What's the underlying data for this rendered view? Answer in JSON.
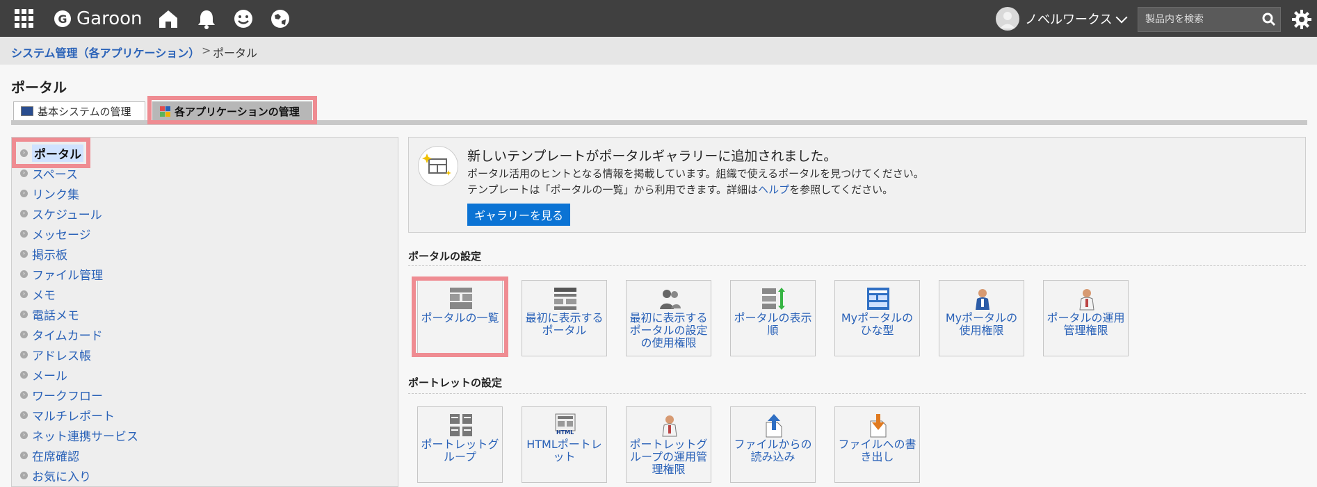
{
  "topbar": {
    "logo_letter": "G",
    "app_title": "Garoon",
    "user_name": "ノベルワークス",
    "search_placeholder": "製品内を検索",
    "icons": [
      "apps-grid-icon",
      "home-icon",
      "bell-icon",
      "smile-icon",
      "globe-icon",
      "search-icon",
      "gear-icon"
    ]
  },
  "breadcrumb": {
    "parent": "システム管理（各アプリケーション）",
    "separator": ">",
    "current": "ポータル"
  },
  "page": {
    "title": "ポータル",
    "tabs": [
      {
        "label": "基本システムの管理",
        "active": false
      },
      {
        "label": "各アプリケーションの管理",
        "active": true
      }
    ]
  },
  "sidebar": {
    "items": [
      {
        "label": "ポータル",
        "selected": true
      },
      {
        "label": "スペース"
      },
      {
        "label": "リンク集"
      },
      {
        "label": "スケジュール"
      },
      {
        "label": "メッセージ"
      },
      {
        "label": "掲示板"
      },
      {
        "label": "ファイル管理"
      },
      {
        "label": "メモ"
      },
      {
        "label": "電話メモ"
      },
      {
        "label": "タイムカード"
      },
      {
        "label": "アドレス帳"
      },
      {
        "label": "メール"
      },
      {
        "label": "ワークフロー"
      },
      {
        "label": "マルチレポート"
      },
      {
        "label": "ネット連携サービス"
      },
      {
        "label": "在席確認"
      },
      {
        "label": "お気に入り"
      }
    ]
  },
  "notice": {
    "title": "新しいテンプレートがポータルギャラリーに追加されました。",
    "line1": "ポータル活用のヒントとなる情報を掲載しています。組織で使えるポータルを見つけてください。",
    "line2_before": "テンプレートは「ポータルの一覧」から利用できます。詳細は",
    "line2_link": "ヘルプ",
    "line2_after": "を参照してください。",
    "button": "ギャラリーを見る"
  },
  "sections": {
    "portal_settings": {
      "title": "ポータルの設定",
      "tiles": [
        {
          "label": "ポータルの一覧",
          "icon": "portal-list-icon"
        },
        {
          "label": "最初に表示するポータル",
          "icon": "portal-layout-icon"
        },
        {
          "label": "最初に表示するポータルの設定の使用権限",
          "icon": "users-icon"
        },
        {
          "label": "ポータルの表示順",
          "icon": "sort-order-icon"
        },
        {
          "label": "Myポータルのひな型",
          "icon": "template-icon"
        },
        {
          "label": "Myポータルの使用権限",
          "icon": "person-icon"
        },
        {
          "label": "ポータルの運用管理権限",
          "icon": "admin-person-icon"
        }
      ]
    },
    "portlet_settings": {
      "title": "ポートレットの設定",
      "tiles": [
        {
          "label": "ポートレットグループ",
          "icon": "portlet-group-icon"
        },
        {
          "label": "HTMLポートレット",
          "icon": "html-portlet-icon",
          "badge": "HTML"
        },
        {
          "label": "ポートレットグループの運用管理権限",
          "icon": "admin-person-icon"
        },
        {
          "label": "ファイルからの読み込み",
          "icon": "file-import-icon"
        },
        {
          "label": "ファイルへの書き出し",
          "icon": "file-export-icon"
        }
      ]
    }
  },
  "colors": {
    "topbar": "#404040",
    "link": "#2a62b8",
    "button": "#0b73d4",
    "highlight": "#ef8c92",
    "tab_active": "#b7b7b7"
  }
}
